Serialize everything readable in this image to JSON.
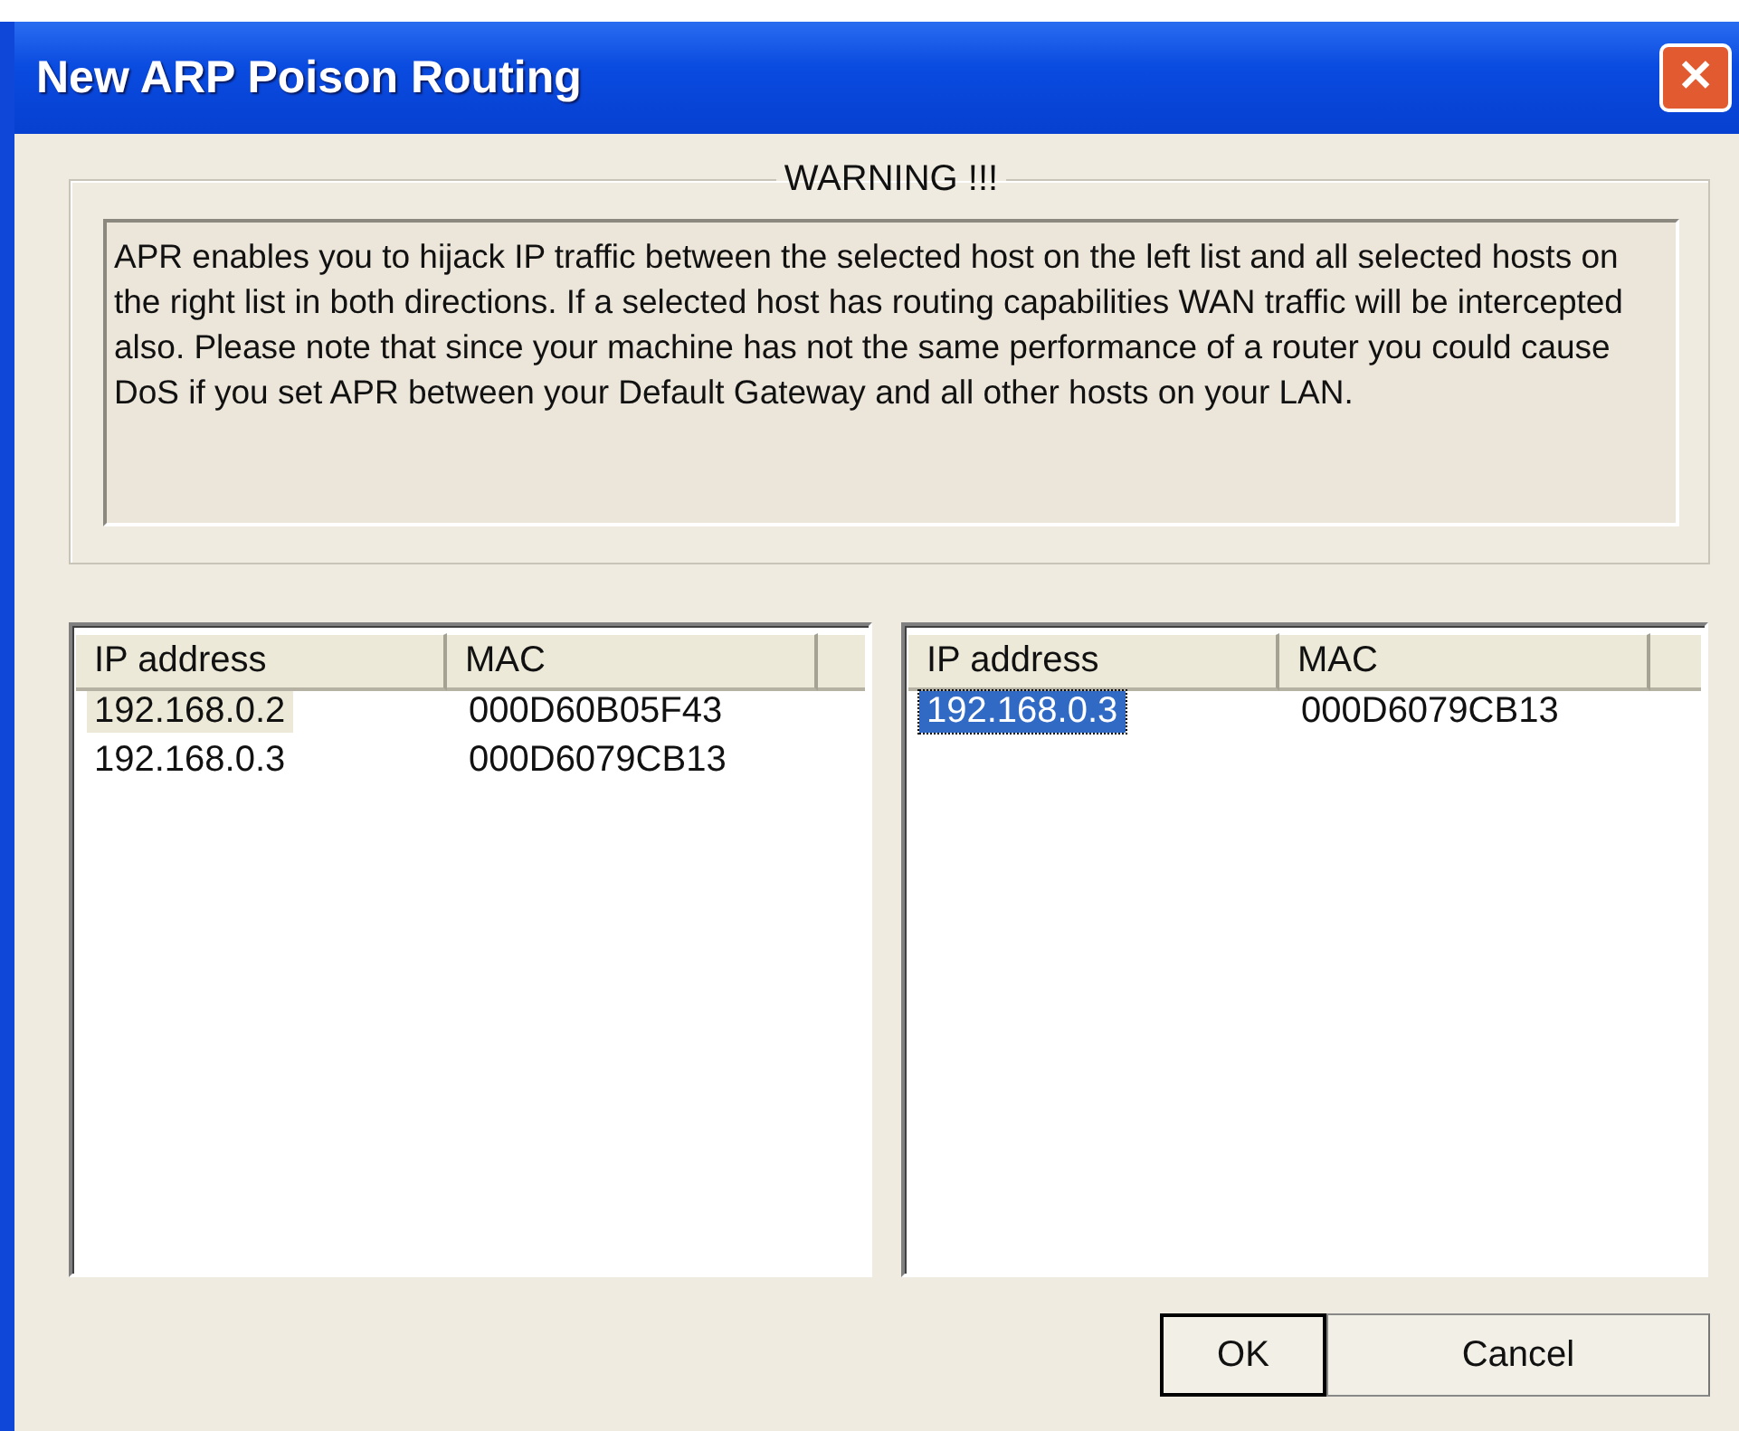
{
  "window": {
    "title": "New ARP Poison Routing",
    "close_button": "✕"
  },
  "warning": {
    "title": "WARNING !!!",
    "text": "APR enables you to hijack IP traffic between the selected host on the left list and all selected hosts on the right list in both directions. If a selected host has routing capabilities WAN traffic will be intercepted also. Please note that since your machine has not the same performance of a router you could cause DoS if you set APR between your Default Gateway and all other hosts on your LAN."
  },
  "lists": [
    {
      "focused": false,
      "columns": [
        "IP address",
        "MAC"
      ],
      "rows": [
        {
          "ip": "192.168.0.2",
          "mac": "000D60B05F43",
          "selected": true
        },
        {
          "ip": "192.168.0.3",
          "mac": "000D6079CB13",
          "selected": false
        }
      ]
    },
    {
      "focused": true,
      "columns": [
        "IP address",
        "MAC"
      ],
      "rows": [
        {
          "ip": "192.168.0.3",
          "mac": "000D6079CB13",
          "selected": true
        }
      ]
    }
  ],
  "buttons": [
    {
      "label": "OK",
      "default": true
    },
    {
      "label": "Cancel",
      "default": false
    }
  ]
}
